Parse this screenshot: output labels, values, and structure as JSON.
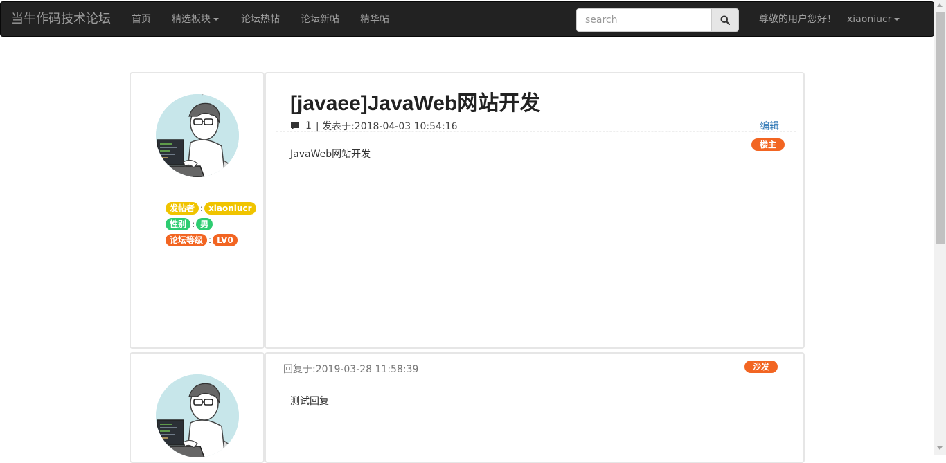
{
  "navbar": {
    "brand": "当牛作码技术论坛",
    "items": [
      {
        "label": "首页"
      },
      {
        "label": "精选板块"
      },
      {
        "label": "论坛热帖"
      },
      {
        "label": "论坛新帖"
      },
      {
        "label": "精华帖"
      }
    ],
    "search_placeholder": "search",
    "greeting": "尊敬的用户您好！",
    "username": "xiaoniucr",
    "colors": {
      "bg": "#222222",
      "text": "#9d9d9d"
    }
  },
  "post": {
    "title": "[javaee]JavaWeb网站开发",
    "reply_count": "1",
    "posted_at": "| 发表于:2018-04-03 10:54:16",
    "edit_label": "编辑",
    "floor_badge": "楼主",
    "content": "JavaWeb网站开发",
    "author": {
      "poster_label": "发帖者",
      "poster_value": "xiaoniucr",
      "gender_label": "性别",
      "gender_value": "男",
      "level_label": "论坛等级",
      "level_value": "LV0",
      "separator": ":"
    }
  },
  "reply": {
    "replied_at": "回复于:2019-03-28 11:58:39",
    "floor_badge": "沙发",
    "content": "测试回复"
  },
  "colors": {
    "badge_yellow": "#f0c400",
    "badge_green": "#2ecc71",
    "badge_orange": "#f26522",
    "link": "#337ab7"
  }
}
